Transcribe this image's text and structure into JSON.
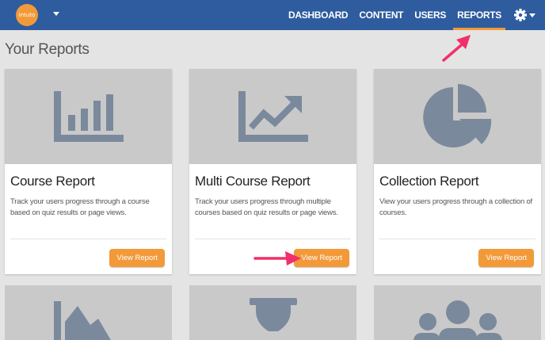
{
  "header": {
    "logo_text": "intuto",
    "nav": [
      {
        "label": "DASHBOARD"
      },
      {
        "label": "CONTENT"
      },
      {
        "label": "USERS"
      },
      {
        "label": "REPORTS",
        "active": true
      }
    ]
  },
  "page_title": "Your Reports",
  "cards": [
    {
      "title": "Course Report",
      "description": "Track your users progress through a course based on quiz results or page views.",
      "button": "View Report",
      "icon": "bar-chart-icon"
    },
    {
      "title": "Multi Course Report",
      "description": "Track your users progress through multiple courses based on quiz results or page views.",
      "button": "View Report",
      "icon": "trend-chart-icon"
    },
    {
      "title": "Collection Report",
      "description": "View your users progress through a collection of courses.",
      "button": "View Report",
      "icon": "pie-chart-icon"
    }
  ],
  "bottom_cards": [
    {
      "icon": "area-chart-icon"
    },
    {
      "icon": "hourglass-icon"
    },
    {
      "icon": "users-group-icon"
    }
  ],
  "colors": {
    "topbar": "#2e5c9e",
    "accent": "#f29a3a",
    "icon": "#7a8a9c",
    "annotation_arrow": "#f0306a"
  }
}
